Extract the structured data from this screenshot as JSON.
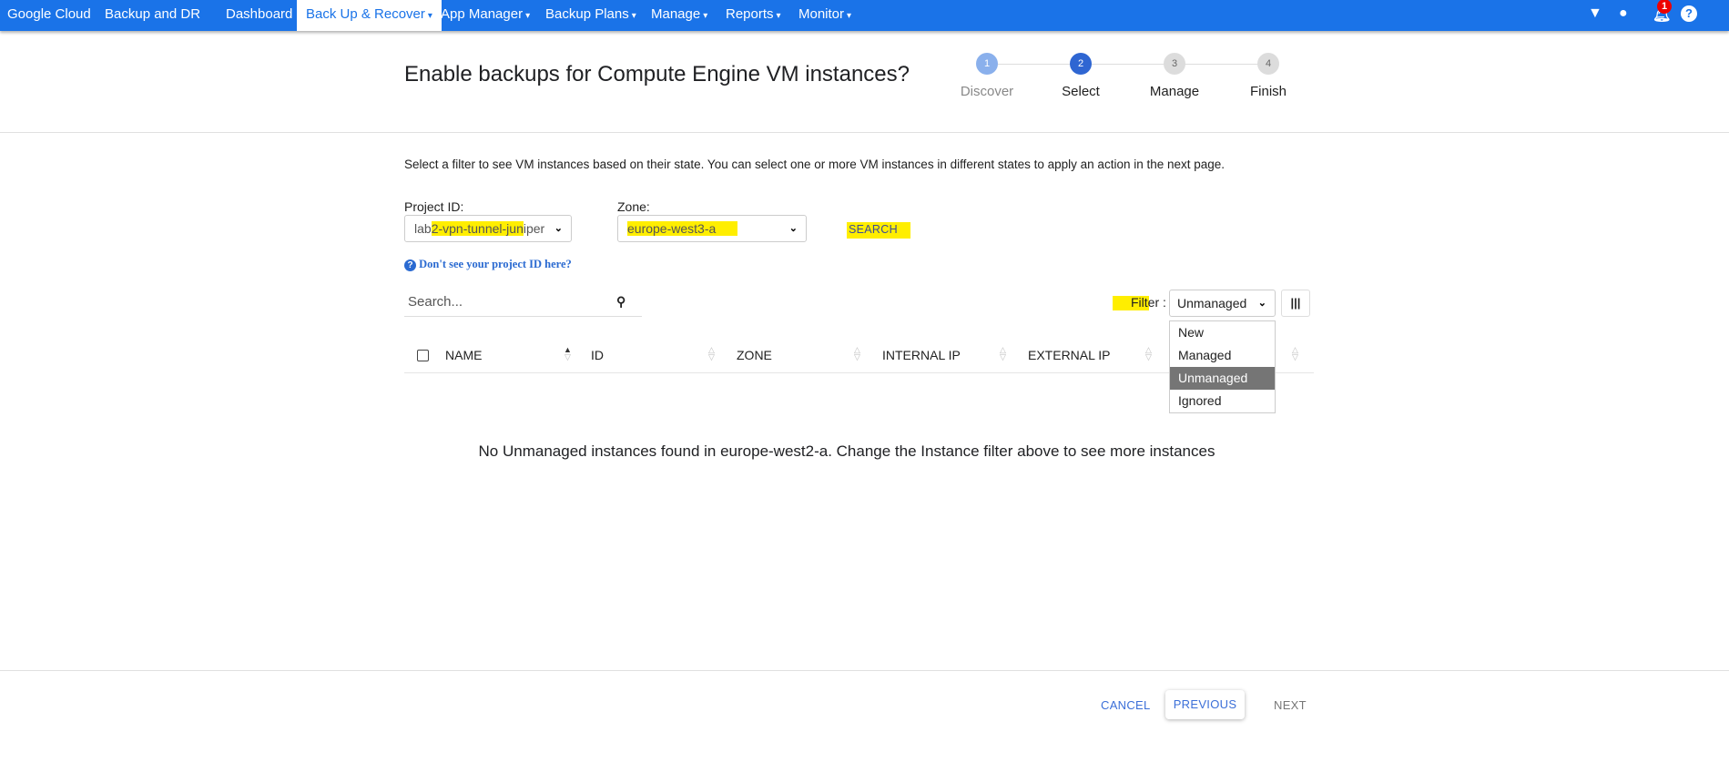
{
  "nav": {
    "brand": "Google Cloud",
    "product": "Backup and DR",
    "items": [
      {
        "label": "Dashboard"
      },
      {
        "label": "Back Up & Recover",
        "active": true
      },
      {
        "label": "App Manager"
      },
      {
        "label": "Backup Plans"
      },
      {
        "label": "Manage"
      },
      {
        "label": "Reports"
      },
      {
        "label": "Monitor"
      }
    ],
    "notification_count": "1",
    "icons": [
      "filter-icon",
      "user-icon",
      "bell-icon",
      "help-icon"
    ]
  },
  "header": {
    "title": "Enable backups for Compute Engine VM instances?",
    "steps": [
      {
        "num": "1",
        "label": "Discover",
        "state": "done"
      },
      {
        "num": "2",
        "label": "Select",
        "state": "current"
      },
      {
        "num": "3",
        "label": "Manage",
        "state": "pending"
      },
      {
        "num": "4",
        "label": "Finish",
        "state": "pending"
      }
    ]
  },
  "main": {
    "instruction": "Select a filter to see VM instances based on their state. You can select one or more VM instances in different states to apply an action in the next page.",
    "project_label": "Project ID:",
    "project_value_a": "lab",
    "project_value_b": "2-vpn-tunnel-jun",
    "project_value_c": "iper",
    "zone_label": "Zone:",
    "zone_value": "europe-west3-a",
    "search_button": "SEARCH",
    "help_link": "Don't see your project ID here?",
    "search_placeholder": "Search...",
    "filter_label": "Filter :",
    "filter_value": "Unmanaged",
    "filter_options": [
      "New",
      "Managed",
      "Unmanaged",
      "Ignored"
    ],
    "columns": [
      "NAME",
      "ID",
      "ZONE",
      "INTERNAL IP",
      "EXTERNAL IP"
    ],
    "empty_message": "No Unmanaged instances found in europe-west2-a. Change the Instance filter above to see more instances"
  },
  "footer": {
    "cancel": "CANCEL",
    "previous": "PREVIOUS",
    "next": "NEXT"
  },
  "colors": {
    "nav": "#1a73e8",
    "step_done": "#8ab0ec",
    "step_current": "#2f66d2",
    "highlight": "#ffee00"
  }
}
